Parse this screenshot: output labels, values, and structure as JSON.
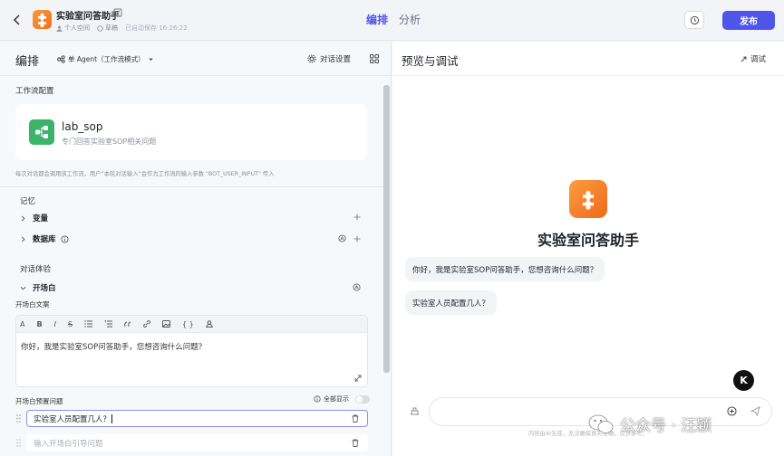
{
  "topbar": {
    "bot_title": "实验室问答助手",
    "space": "个人空间",
    "status": "草稿",
    "autosave": "已自动保存 16:26:22",
    "tabs": [
      "编排",
      "分析"
    ],
    "publish_label": "发布"
  },
  "left": {
    "title": "编排",
    "agent_mode": "单 Agent（工作流模式）",
    "dialog_settings": "对话设置",
    "workflow_section": "工作流配置",
    "workflow": {
      "name": "lab_sop",
      "description": "专门回答实验室SOP相关问题",
      "note": "每次对话都会调用该工作流，用户“本轮对话输入”会作为工作流的输入参数 \"BOT_USER_INPUT\" 传入"
    },
    "memory_section": "记忆",
    "memory_items": [
      "变量",
      "数据库"
    ],
    "experience_section": "对话体验",
    "opening_label": "开场白",
    "opening_text_label": "开场白文案",
    "opening_text": "你好，我是实验室SOP问答助手，您想咨询什么问题？",
    "preset_label": "开场白预置问题",
    "show_all": "全部显示",
    "preset_questions": [
      "实验室人员配置几人？"
    ],
    "preset_placeholder": "输入开场白引导问题",
    "toolbar": [
      "A",
      "B",
      "I",
      "S"
    ]
  },
  "right": {
    "title": "预览与调试",
    "debug_label": "调试",
    "bot_name": "实验室问答助手",
    "messages": [
      "你好，我是实验室SOP问答助手，您想咨询什么问题？",
      "实验室人员配置几人？"
    ],
    "disclaimer": "内容由AI生成，无法确保真实准确，仅供参考。"
  },
  "watermark": {
    "text": "公众号 · 汪颖"
  },
  "badge": {
    "letter": "K"
  },
  "colors": {
    "accent": "#4e55e8",
    "workflow_icon": "#3bb36a",
    "bot_logo": "#f58a2e"
  }
}
